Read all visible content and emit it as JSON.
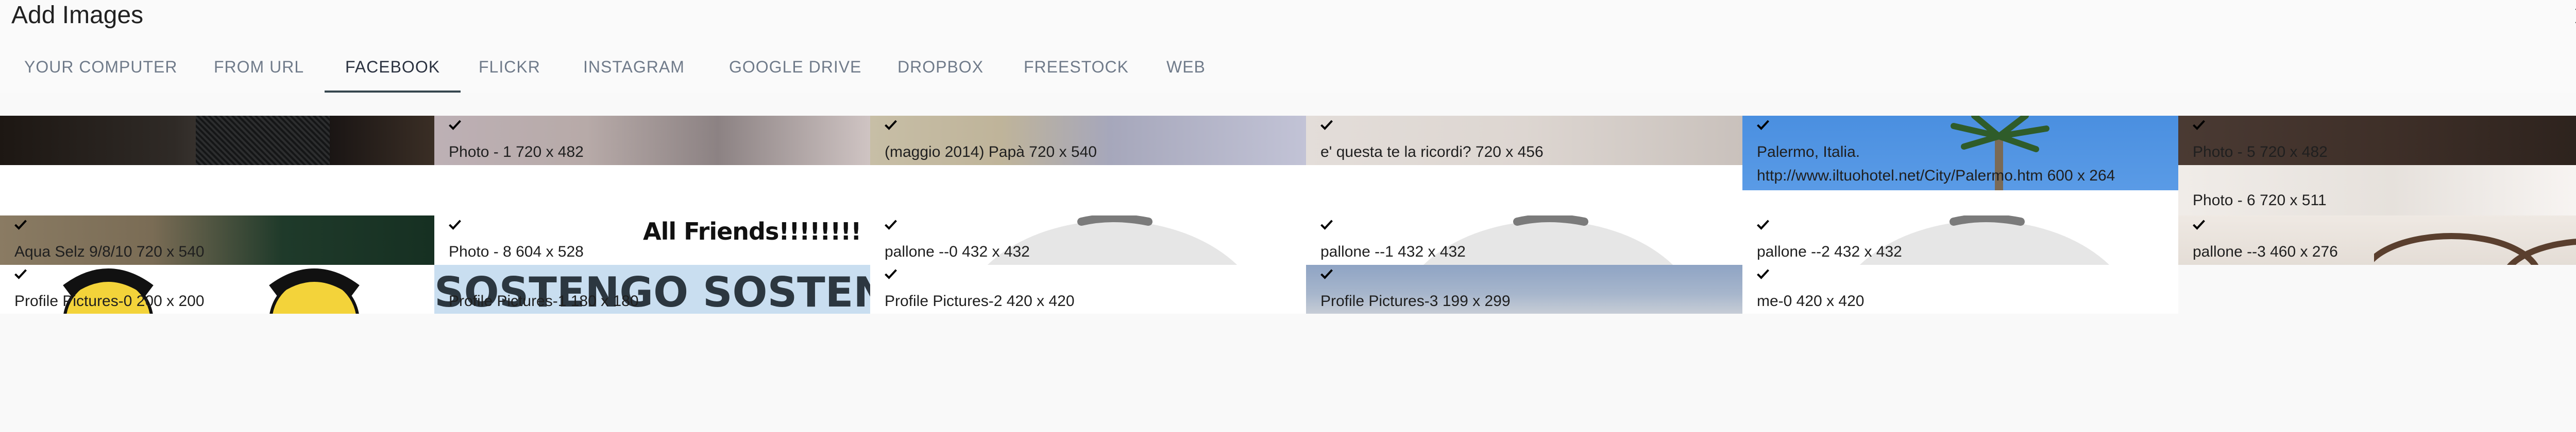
{
  "dialog": {
    "title": "Add Images"
  },
  "tabs": [
    {
      "label": "YOUR COMPUTER"
    },
    {
      "label": "FROM URL"
    },
    {
      "label": "FACEBOOK"
    },
    {
      "label": "FLICKR"
    },
    {
      "label": "INSTAGRAM"
    },
    {
      "label": "GOOGLE DRIVE"
    },
    {
      "label": "DROPBOX"
    },
    {
      "label": "FREESTOCK"
    },
    {
      "label": "WEB"
    }
  ],
  "active_tab": "FACEBOOK",
  "photos": [
    {
      "label": ""
    },
    {
      "label": "Photo - 1 720 x 482"
    },
    {
      "label": "(maggio 2014) Papà 720 x 540"
    },
    {
      "label": "e' questa te la ricordi? 720 x 456"
    },
    {
      "label": "Palermo, Italia.\nhttp://www.iltuohotel.net/City/Palermo.htm 600 x 264"
    },
    {
      "label": "Photo - 5 720 x 482"
    },
    {
      "label": "Photo - 6 720 x 511"
    },
    {
      "label": "Aqua Selz 9/8/10 720 x 540"
    },
    {
      "label": "Photo - 8 604 x 528"
    },
    {
      "label": "pallone --0 432 x 432"
    },
    {
      "label": "pallone --1 432 x 432"
    },
    {
      "label": "pallone --2 432 x 432"
    },
    {
      "label": "pallone --3 460 x 276"
    },
    {
      "label": "Profile Pictures-0 200 x 200"
    },
    {
      "label": "Profile Pictures-1 180 x 180"
    },
    {
      "label": "Profile Pictures-2 420 x 420"
    },
    {
      "label": "Profile Pictures-3 199 x 299"
    },
    {
      "label": "me-0 420 x 420"
    }
  ],
  "image_overlays": {
    "all_friends": "All Friends!!!!!!!!",
    "sostengo": "SOSTENGO SOSTENGO SOS"
  },
  "icons": {
    "close": "close-icon",
    "check": "check-icon"
  }
}
